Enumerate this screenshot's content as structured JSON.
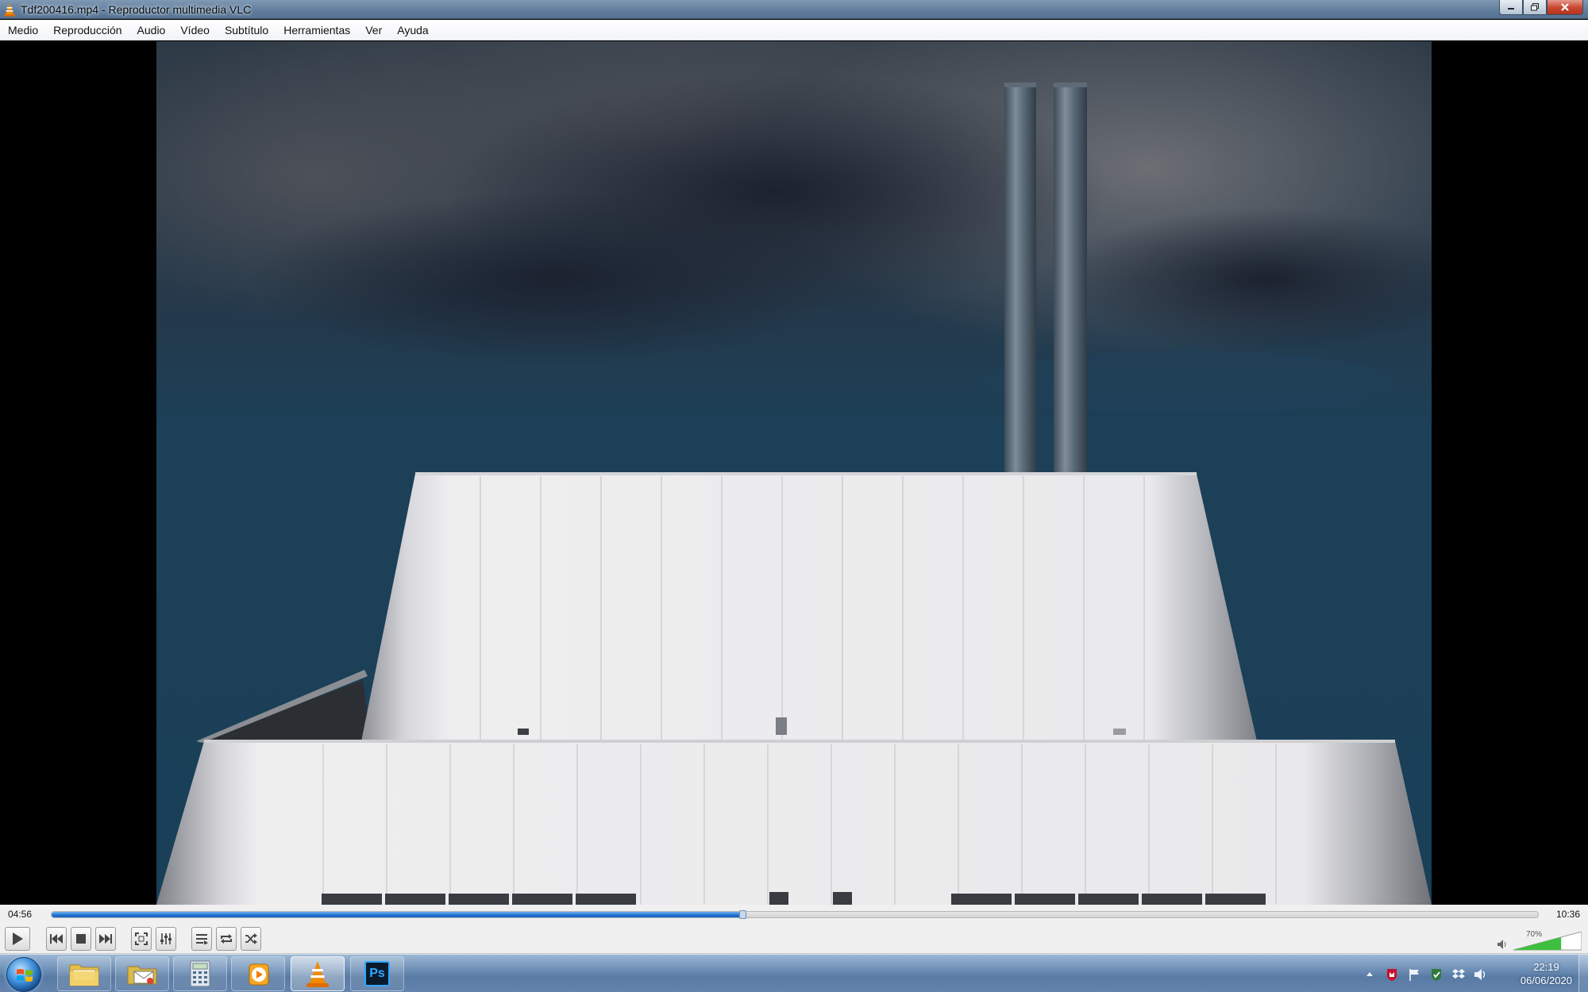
{
  "window": {
    "title": "Tdf200416.mp4 - Reproductor multimedia VLC",
    "icon": "vlc-cone-icon",
    "controls": [
      "minimize-icon",
      "maximize-icon",
      "close-icon"
    ]
  },
  "menu": {
    "items": [
      "Medio",
      "Reproducción",
      "Audio",
      "Vídeo",
      "Subtítulo",
      "Herramientas",
      "Ver",
      "Ayuda"
    ]
  },
  "playback": {
    "elapsed": "04:56",
    "total": "10:36",
    "progress_fraction": 0.4654
  },
  "controls": {
    "buttons": [
      "play-icon",
      "previous-icon",
      "stop-icon",
      "next-icon",
      "fullscreen-icon",
      "extended-settings-icon",
      "playlist-icon",
      "loop-icon",
      "shuffle-icon"
    ],
    "volume_label": "70%",
    "volume_fraction": 0.7
  },
  "taskbar": {
    "items": [
      "start-orb",
      "explorer-folder-icon",
      "email-icon",
      "calculator-icon",
      "media-player-icon",
      "vlc-cone-icon",
      "photoshop-icon"
    ],
    "photoshop_label": "Ps",
    "clock_time": "22:19",
    "clock_date": "06/06/2020"
  },
  "colors": {
    "accent_seek": "#1f6fcf",
    "vlc_orange": "#f08a00",
    "volume_green": "#3fbf3f"
  }
}
